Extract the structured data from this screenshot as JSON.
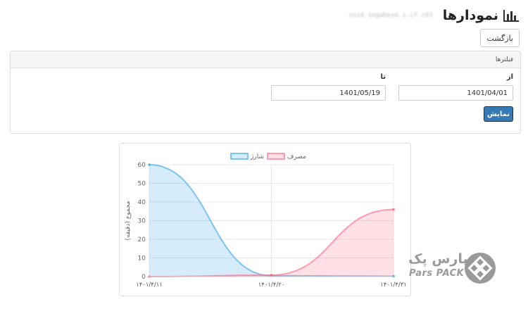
{
  "header": {
    "title": "نمودارها",
    "subtitle": "void.segwheye.s.cf.c93",
    "icon": "bar-chart-icon"
  },
  "back_button": {
    "label": "بازگشت"
  },
  "filters": {
    "heading": "فیلترها",
    "from_label": "از",
    "from_value": "1401/04/01",
    "to_label": "تا",
    "to_value": "1401/05/19",
    "submit_label": "نمایش",
    "submit_color": "#337ab7"
  },
  "chart_data": {
    "type": "area",
    "x": [
      "۱۴۰۱/۴/۱۱",
      "۱۴۰۱/۴/۲۰",
      "۱۴۰۱/۴/۳۱"
    ],
    "series": [
      {
        "name": "شارژ",
        "values": [
          60,
          0.5,
          0.2
        ],
        "color": "#36a2eb"
      },
      {
        "name": "مصرف",
        "values": [
          0,
          0.8,
          36
        ],
        "color": "#ff6384"
      }
    ],
    "ylabel": "مجموع (دقیقه)",
    "ylim": [
      0,
      60
    ],
    "yticks": [
      "0",
      "10",
      "20",
      "30",
      "40",
      "50",
      "60"
    ],
    "legend": "top",
    "grid": true
  },
  "logo": {
    "text_fa": "پارس پک",
    "text_en": "Pars PACK",
    "color": "#9a9a9a"
  }
}
